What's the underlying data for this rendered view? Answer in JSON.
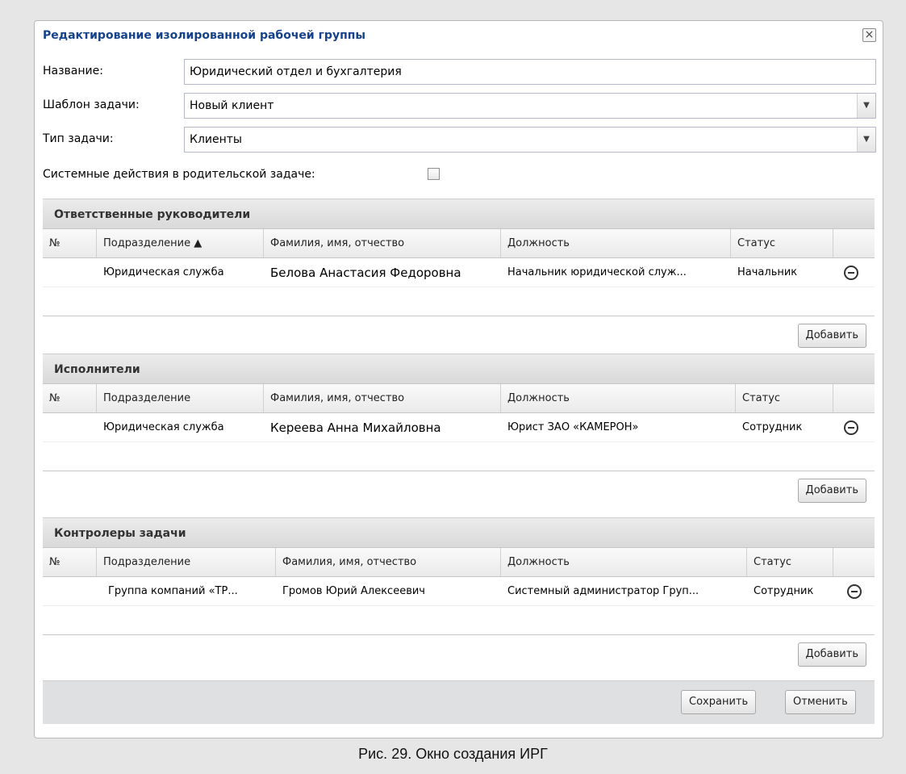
{
  "dialog": {
    "title": "Редактирование изолированной рабочей группы",
    "close_symbol": "×"
  },
  "form": {
    "name_label": "Название:",
    "name_value": "Юридический отдел и бухгалтерия",
    "template_label": "Шаблон задачи:",
    "template_value": "Новый клиент",
    "type_label": "Тип задачи:",
    "type_value": "Клиенты",
    "system_actions_label": "Системные действия в родительской задаче:",
    "system_actions_checked": false
  },
  "sections": {
    "managers": {
      "title": "Ответственные руководители",
      "columns": [
        "№",
        "Подразделение ▲",
        "Фамилия, имя, отчество",
        "Должность",
        "Статус"
      ],
      "rows": [
        [
          "",
          "Юридическая служба",
          "Белова Анастасия Федоровна",
          "Начальник юридической служ...",
          "Начальник"
        ]
      ],
      "add_label": "Добавить"
    },
    "executors": {
      "title": "Исполнители",
      "columns": [
        "№",
        "Подразделение",
        "Фамилия, имя, отчество",
        "Должность",
        "Статус"
      ],
      "rows": [
        [
          "",
          "Юридическая служба",
          "Кереева Анна Михайловна",
          "Юрист ЗАО «КАМЕРОН»",
          "Сотрудник"
        ]
      ],
      "add_label": "Добавить"
    },
    "controllers": {
      "title": "Контролеры задачи",
      "columns": [
        "№",
        "Подразделение",
        "Фамилия, имя, отчество",
        "Должность",
        "Статус"
      ],
      "rows": [
        [
          "",
          "Группа компаний «ТР...",
          "Громов Юрий Алексеевич",
          "Системный администратор Груп...",
          "Сотрудник"
        ]
      ],
      "add_label": "Добавить"
    }
  },
  "footer": {
    "save_label": "Сохранить",
    "cancel_label": "Отменить"
  },
  "caption": "Рис. 29. Окно создания ИРГ",
  "icons": {
    "combo_arrow": "chevron-down-icon",
    "remove": "minus-circle-icon",
    "close": "close-icon"
  },
  "colors": {
    "title_text": "#15428b",
    "section_header_bg": "#dcdcdc",
    "footer_bg": "#dfe0e2",
    "page_bg": "#e6e6e6"
  }
}
